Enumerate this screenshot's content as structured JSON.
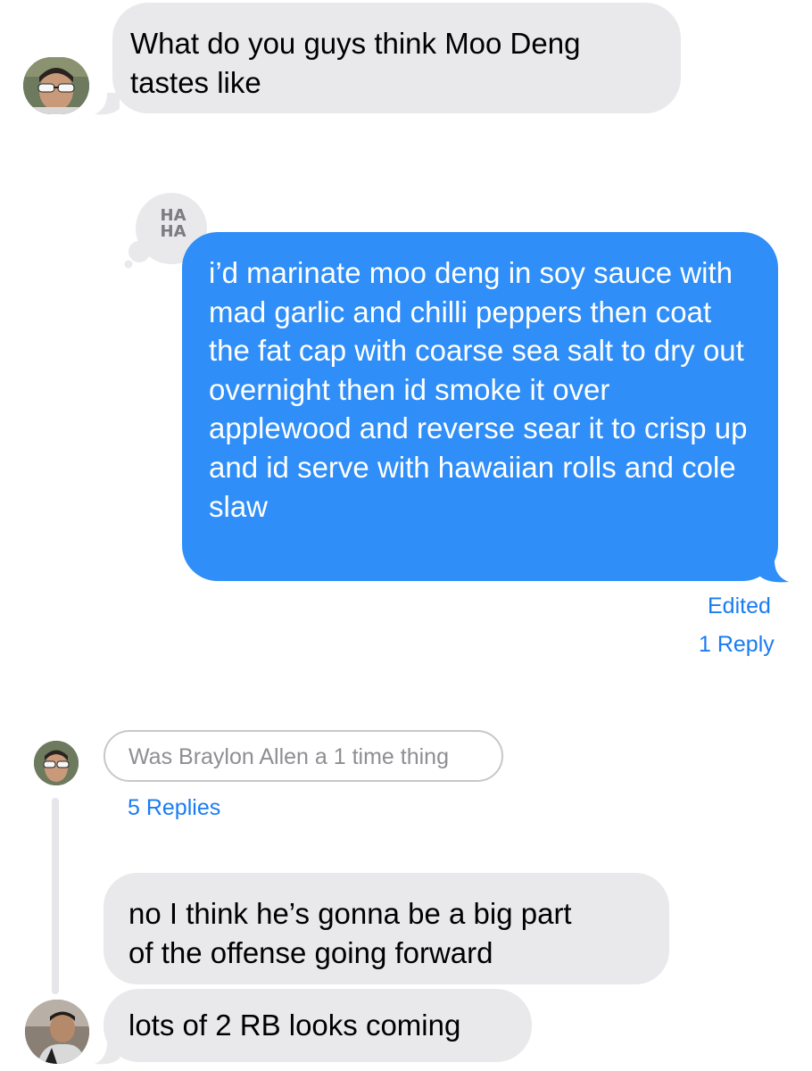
{
  "messages": [
    {
      "id": "msg1",
      "direction": "incoming",
      "text": "What do you guys think Moo Deng\ntastes like"
    },
    {
      "id": "msg2",
      "direction": "outgoing",
      "reaction": "HA\nHA",
      "text": "i’d marinate moo deng in soy sauce with mad garlic and chilli peppers then coat the fat cap with coarse sea salt  to dry out overnight then id smoke it over applewood and reverse sear it to crisp up and id serve with hawaiian rolls and cole slaw",
      "edited_label": "Edited",
      "replies_label": "1 Reply"
    },
    {
      "id": "msg3",
      "direction": "incoming",
      "style": "reply-context",
      "text": "Was Braylon Allen a 1 time thing",
      "replies_label": "5 Replies"
    },
    {
      "id": "msg4",
      "direction": "incoming",
      "text": "no I think he’s gonna be a big part\nof the offense going forward"
    },
    {
      "id": "msg5",
      "direction": "incoming",
      "text": "lots of 2 RB looks coming"
    }
  ],
  "colors": {
    "incoming_bubble": "#e9e9eb",
    "outgoing_bubble": "#2f8ef8",
    "link": "#1a7cf2",
    "muted_text": "#8e8e93"
  }
}
